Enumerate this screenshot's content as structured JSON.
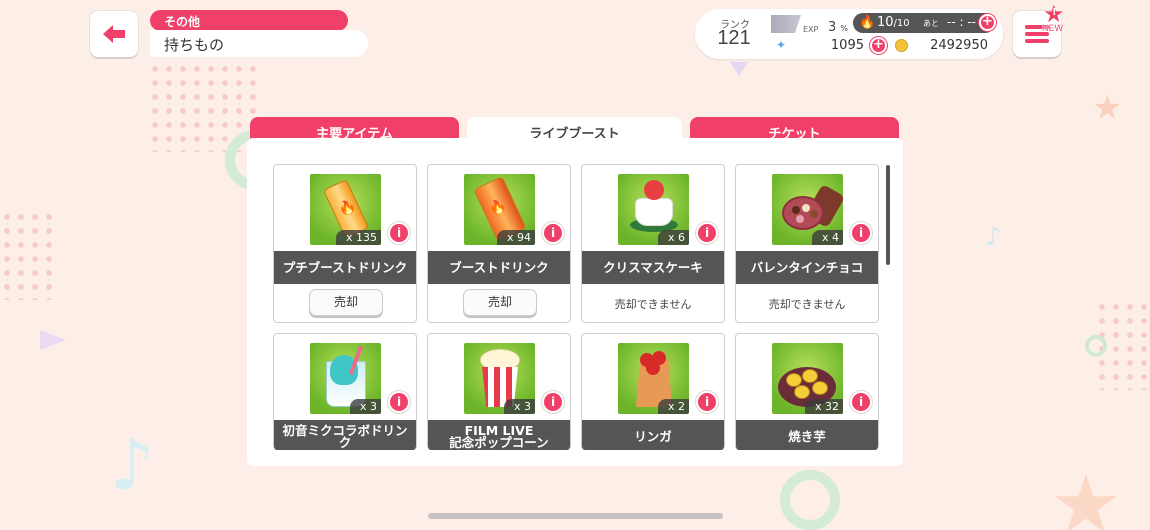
{
  "header": {
    "back_icon": "left-arrow-icon",
    "crumb_category": "その他",
    "crumb_title": "持ちもの"
  },
  "status": {
    "rank_label": "ランク",
    "rank_value": "121",
    "exp_label": "EXP",
    "exp_percent": "3",
    "exp_percent_unit": "%",
    "stamina_value": "10",
    "stamina_max": "/10",
    "stamina_after_label": "あと",
    "stamina_timer": "-- : --",
    "gems": "1095",
    "coins": "2492950"
  },
  "menu": {
    "new_badge": "NEW",
    "new_badge_mark": "!"
  },
  "tabs": [
    {
      "label": "主要アイテム",
      "active": false
    },
    {
      "label": "ライブブースト",
      "active": true
    },
    {
      "label": "チケット",
      "active": false
    }
  ],
  "items": [
    {
      "name": "プチブーストドリンク",
      "qty": "x 135",
      "action": "売却",
      "sellable": true,
      "art": "small-drink"
    },
    {
      "name": "ブーストドリンク",
      "qty": "x 94",
      "action": "売却",
      "sellable": true,
      "art": "drink"
    },
    {
      "name": "クリスマスケーキ",
      "qty": "x 6",
      "action": "売却できません",
      "sellable": false,
      "art": "cake"
    },
    {
      "name": "バレンタインチョコ",
      "qty": "x 4",
      "action": "売却できません",
      "sellable": false,
      "art": "choco"
    },
    {
      "name_line1": "初音ミクコラボドリン",
      "name_line2": "ク",
      "qty": "x 3",
      "art": "miku-drink"
    },
    {
      "name_line1": "FILM LIVE",
      "name_line2": "記念ポップコーン",
      "qty": "x 3",
      "art": "popcorn"
    },
    {
      "name": "リンガ",
      "qty": "x 2",
      "art": "apples"
    },
    {
      "name": "焼き芋",
      "qty": "x 32",
      "art": "sweet-potato"
    }
  ],
  "colors": {
    "accent": "#f0406a",
    "background": "#fdeee8",
    "item_bg": "#7cbd30",
    "name_bar": "#555555"
  },
  "info_mark": "i"
}
